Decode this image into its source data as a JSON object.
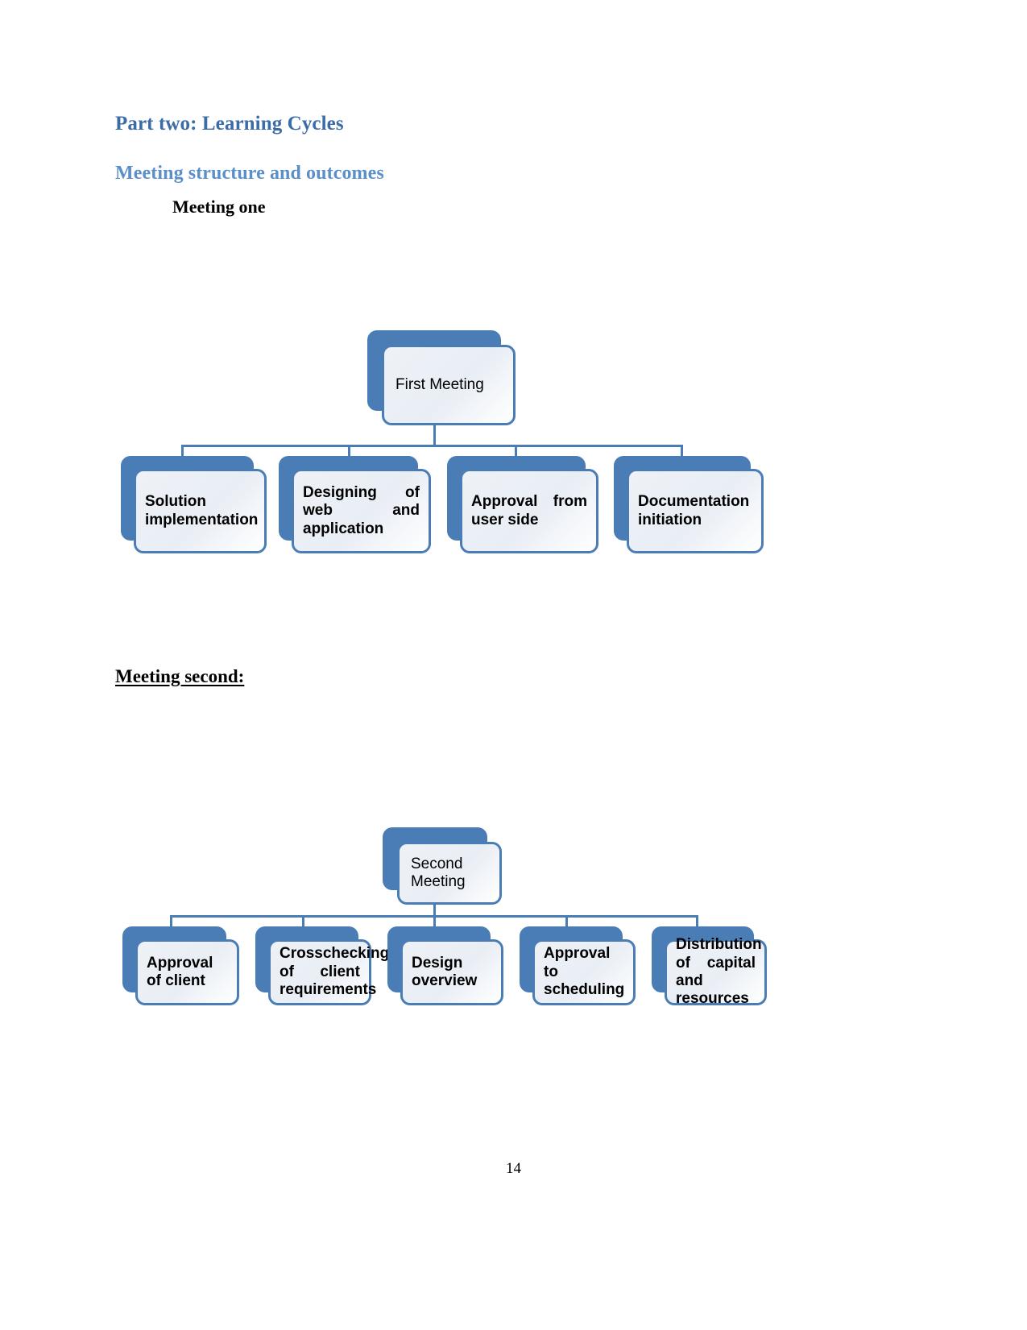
{
  "document": {
    "headings": {
      "part_title": "Part two: Learning Cycles",
      "section_title": "Meeting structure and outcomes",
      "meeting_one": "Meeting one",
      "meeting_second": "Meeting second:"
    },
    "page_number": "14",
    "colors": {
      "part_title": "#3b6ca8",
      "section_title": "#5b8fc9",
      "node_blue": "#4a7db5",
      "node_face": "#eef2f7",
      "text": "#000000"
    }
  },
  "diagram_one": {
    "name": "Meeting one organization chart",
    "root": {
      "label": "First Meeting"
    },
    "children": [
      {
        "label": "Solution implementation"
      },
      {
        "label": "Designing of web and application"
      },
      {
        "label": "Approval from user side"
      },
      {
        "label": "Documentation initiation"
      }
    ]
  },
  "diagram_two": {
    "name": "Meeting second organization chart",
    "root": {
      "label": "Second Meeting"
    },
    "children": [
      {
        "label": "Approval of client"
      },
      {
        "label": "Crosschecking of client requirements"
      },
      {
        "label": "Design overview"
      },
      {
        "label": "Approval to scheduling"
      },
      {
        "label": "Distribution of capital and resources"
      }
    ]
  }
}
